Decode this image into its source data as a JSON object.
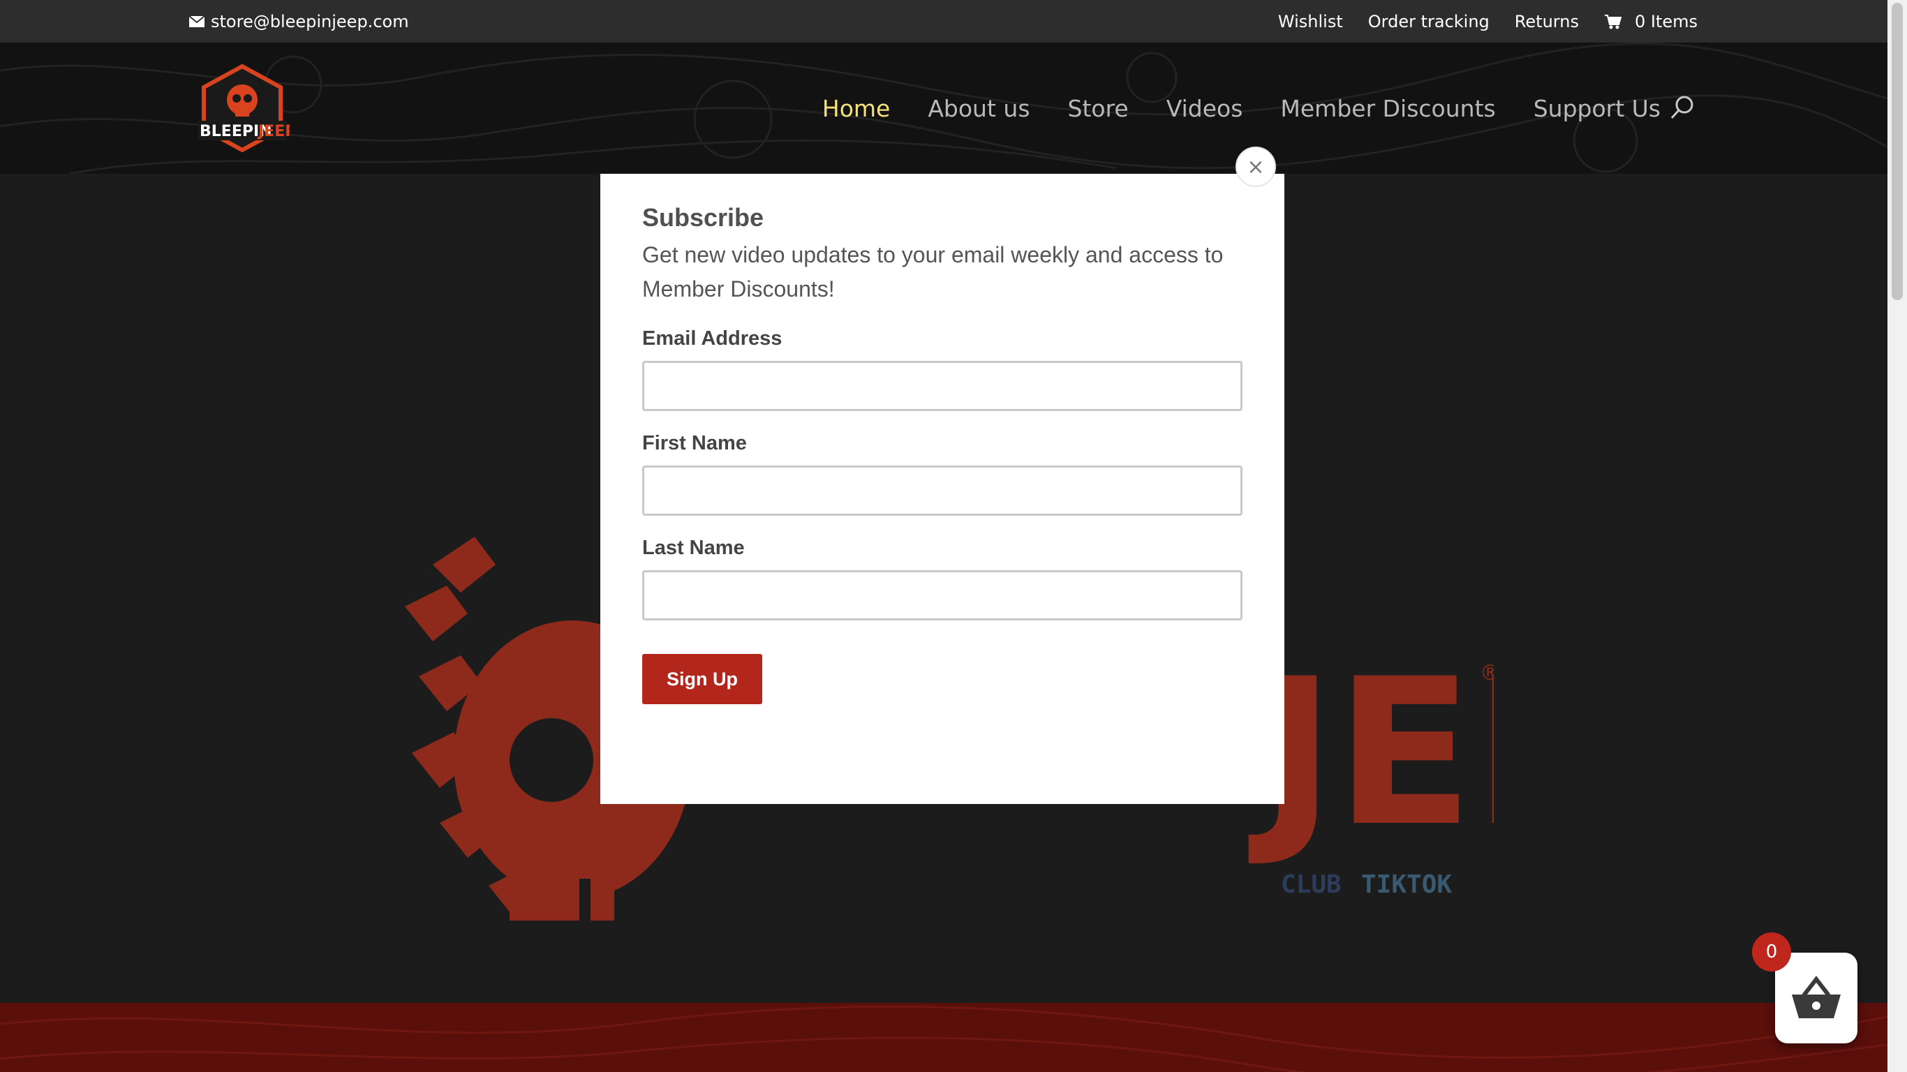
{
  "topbar": {
    "email": "store@bleepinjeep.com",
    "email_icon": "envelope-icon",
    "links": [
      "Wishlist",
      "Order tracking",
      "Returns"
    ],
    "cart_icon": "cart-icon",
    "cart_label": "0 Items"
  },
  "header": {
    "logo_text": [
      "BLEEPIN",
      "JEEP"
    ],
    "nav": [
      "Home",
      "About us",
      "Store",
      "Videos",
      "Member Discounts",
      "Support Us"
    ],
    "active_nav": "Home",
    "search_icon": "search-icon"
  },
  "hero": {
    "logo_text": "JEEP",
    "registered_mark": "®",
    "sub_text": [
      "CLUB",
      "TIKTOK"
    ]
  },
  "modal": {
    "title": "Subscribe",
    "description": "Get new video updates to your email weekly and access to Member Discounts!",
    "fields": [
      {
        "label": "Email Address",
        "value": ""
      },
      {
        "label": "First Name",
        "value": ""
      },
      {
        "label": "Last Name",
        "value": ""
      }
    ],
    "submit_label": "Sign Up",
    "close_icon": "close-icon"
  },
  "floating_cart": {
    "count": "0",
    "icon": "basket-icon"
  },
  "colors": {
    "accent": "#b2261b",
    "nav_active": "#f5e07a",
    "topbar_bg": "#2d2d2d",
    "header_bg": "#121212",
    "footer_band": "#5a0f0b"
  }
}
